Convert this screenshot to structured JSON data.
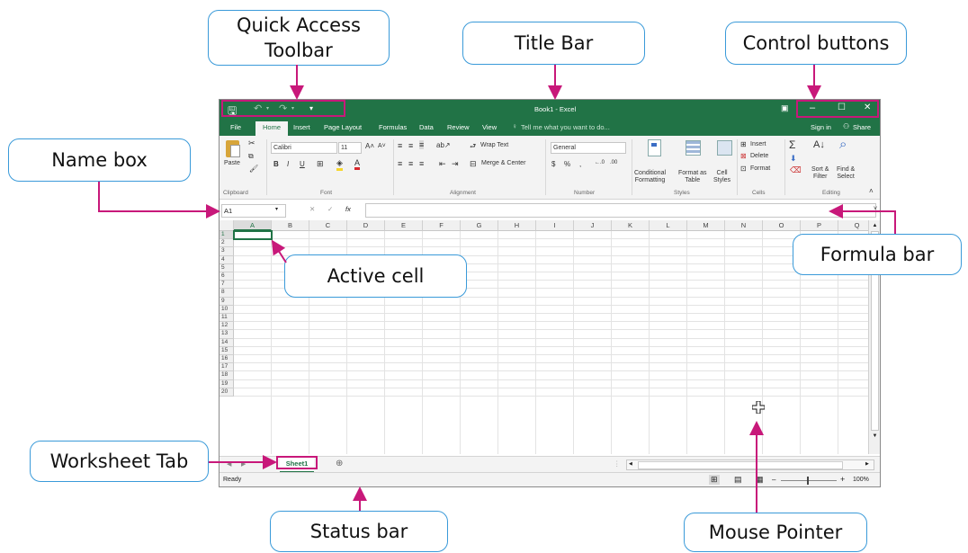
{
  "callouts": {
    "quick_access": "Quick Access\nToolbar",
    "title_bar": "Title Bar",
    "control_buttons": "Control buttons",
    "name_box": "Name box",
    "formula_bar": "Formula bar",
    "active_cell": "Active cell",
    "worksheet_tab": "Worksheet Tab",
    "status_bar": "Status bar",
    "mouse_pointer": "Mouse Pointer"
  },
  "title": "Book1 - Excel",
  "qat": {
    "save": "🖫",
    "undo": "↶",
    "redo": "↷",
    "customize": "▾"
  },
  "window_controls": {
    "ribbon_options": "▣",
    "minimize": "–",
    "maximize": "☐",
    "close": "✕"
  },
  "tabs": [
    "File",
    "Home",
    "Insert",
    "Page Layout",
    "Formulas",
    "Data",
    "Review",
    "View"
  ],
  "tell_me": "Tell me what you want to do...",
  "sign_in": "Sign in",
  "share": "Share",
  "ribbon": {
    "paste": "Paste",
    "font_name": "Calibri",
    "font_size": "11",
    "bold": "B",
    "italic": "I",
    "underline": "U",
    "wrap_text": "Wrap Text",
    "merge_center": "Merge & Center",
    "number_format": "General",
    "currency": "$",
    "percent": "%",
    "comma": ",",
    "inc_decimal": "+.0 .00",
    "dec_decimal": ".00 →.0",
    "conditional_formatting": "Conditional\nFormatting",
    "format_as_table": "Format as\nTable",
    "cell_styles": "Cell\nStyles",
    "insert": "Insert",
    "delete": "Delete",
    "format": "Format",
    "autosum": "Σ",
    "sort_filter": "Sort &\nFilter",
    "find_select": "Find &\nSelect",
    "groups": [
      "Clipboard",
      "Font",
      "Alignment",
      "Number",
      "Styles",
      "Cells",
      "Editing"
    ]
  },
  "formula_bar": {
    "name_box": "A1",
    "cancel": "✕",
    "enter": "✓",
    "fx": "fx",
    "content": ""
  },
  "columns": [
    "A",
    "B",
    "C",
    "D",
    "E",
    "F",
    "G",
    "H",
    "I",
    "J",
    "K",
    "L",
    "M",
    "N",
    "O",
    "P",
    "Q"
  ],
  "rows": [
    "1",
    "2",
    "3",
    "4",
    "5",
    "6",
    "7",
    "8",
    "9",
    "10",
    "11",
    "12",
    "13",
    "14",
    "15",
    "16",
    "17",
    "18",
    "19",
    "20"
  ],
  "sheet_tab": "Sheet1",
  "add_sheet": "⊕",
  "status": {
    "ready": "Ready",
    "zoom": "100%"
  }
}
